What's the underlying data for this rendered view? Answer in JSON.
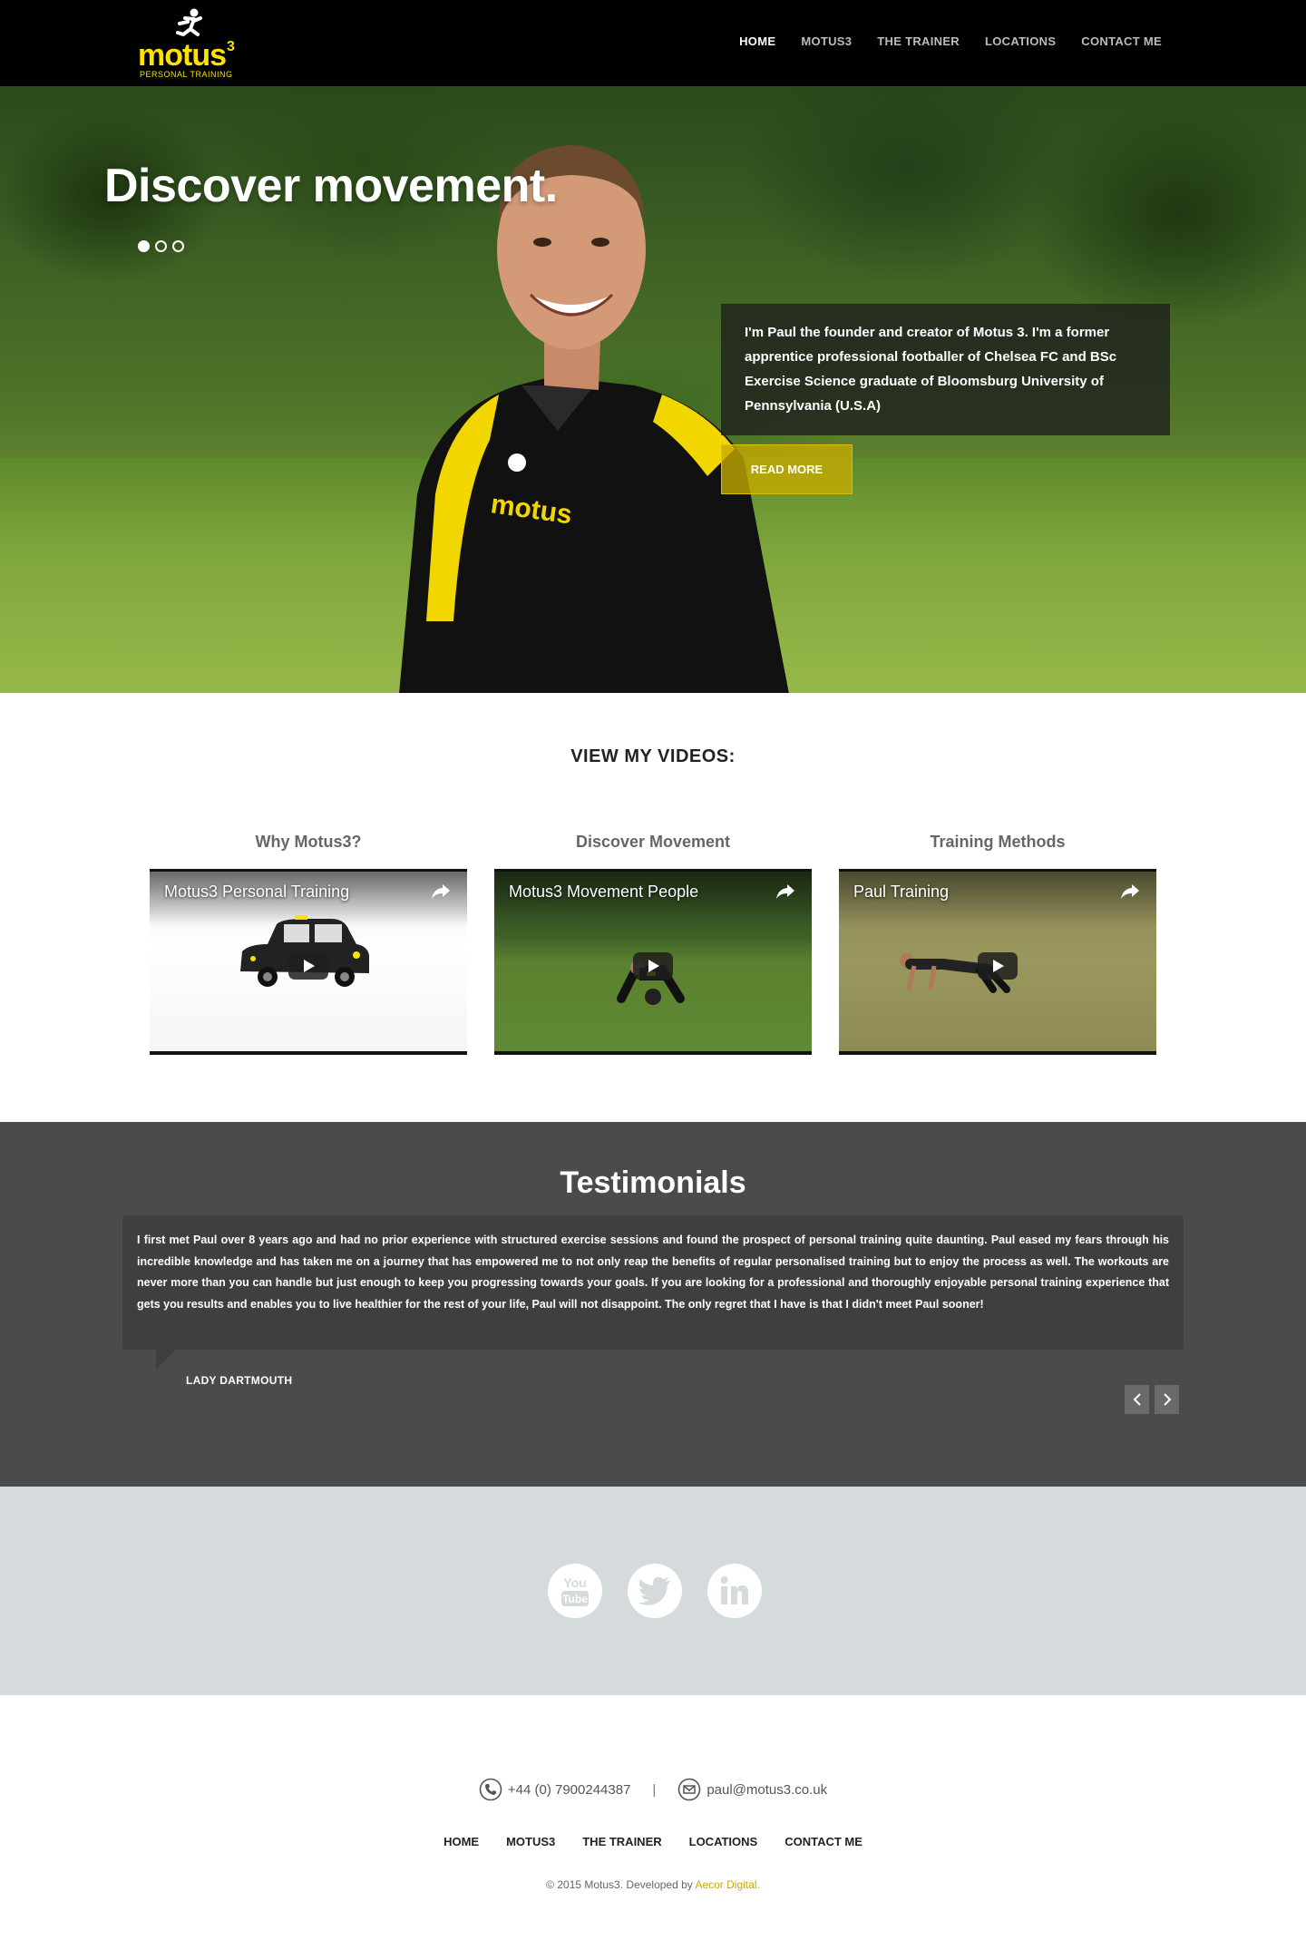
{
  "nav": {
    "logo_text": "motus",
    "logo_sup": "3",
    "logo_sub": "PERSONAL TRAINING",
    "items": [
      {
        "label": "HOME",
        "active": true
      },
      {
        "label": "MOTUS3",
        "active": false
      },
      {
        "label": "THE TRAINER",
        "active": false
      },
      {
        "label": "LOCATIONS",
        "active": false
      },
      {
        "label": "CONTACT ME",
        "active": false
      }
    ]
  },
  "hero": {
    "title": "Discover movement.",
    "slides": 3,
    "active_slide": 1,
    "bubble_text": "I'm Paul the founder and creator of Motus 3. I'm a former apprentice professional footballer of Chelsea FC and BSc Exercise Science graduate of Bloomsburg University of Pennsylvania (U.S.A)",
    "read_more_label": "READ MORE"
  },
  "videos": {
    "heading": "VIEW MY VIDEOS:",
    "items": [
      {
        "title": "Why Motus3?",
        "video_label": "Motus3 Personal Training"
      },
      {
        "title": "Discover Movement",
        "video_label": "Motus3 Movement People"
      },
      {
        "title": "Training Methods",
        "video_label": "Paul Training"
      }
    ]
  },
  "testimonials": {
    "heading": "Testimonials",
    "quote": "I first met Paul over 8 years ago and had no prior experience with structured exercise sessions and found the prospect of personal training quite daunting. Paul eased my fears through his incredible knowledge and has taken me on a journey that has empowered me to not only reap the benefits of regular personalised training but to enjoy the process as well. The workouts are never more than you can handle but just enough to keep you progressing towards your goals. If you are looking for a professional and thoroughly enjoyable personal training experience that gets you results and enables you to live healthier for the rest of your life, Paul will not disappoint. The only regret that I have is that I didn't meet Paul sooner!",
    "author": "LADY DARTMOUTH"
  },
  "social": {
    "icons": [
      "youtube-icon",
      "twitter-icon",
      "linkedin-icon"
    ],
    "youtube_text_top": "You",
    "youtube_text_bottom": "Tube"
  },
  "footer": {
    "phone": "+44 (0) 7900244387",
    "separator": "|",
    "email": "paul@motus3.co.uk",
    "menu": [
      "HOME",
      "MOTUS3",
      "THE TRAINER",
      "LOCATIONS",
      "CONTACT ME"
    ],
    "copyright_prefix": "© 2015 Motus3. Developed by ",
    "developer": "Aecor Digital."
  },
  "colors": {
    "brand_yellow": "#ffe000",
    "nav_bg": "#000000",
    "testimonial_bg": "#4b4b4d",
    "social_bg": "#d5dadd",
    "link_gold": "#c9a800"
  }
}
